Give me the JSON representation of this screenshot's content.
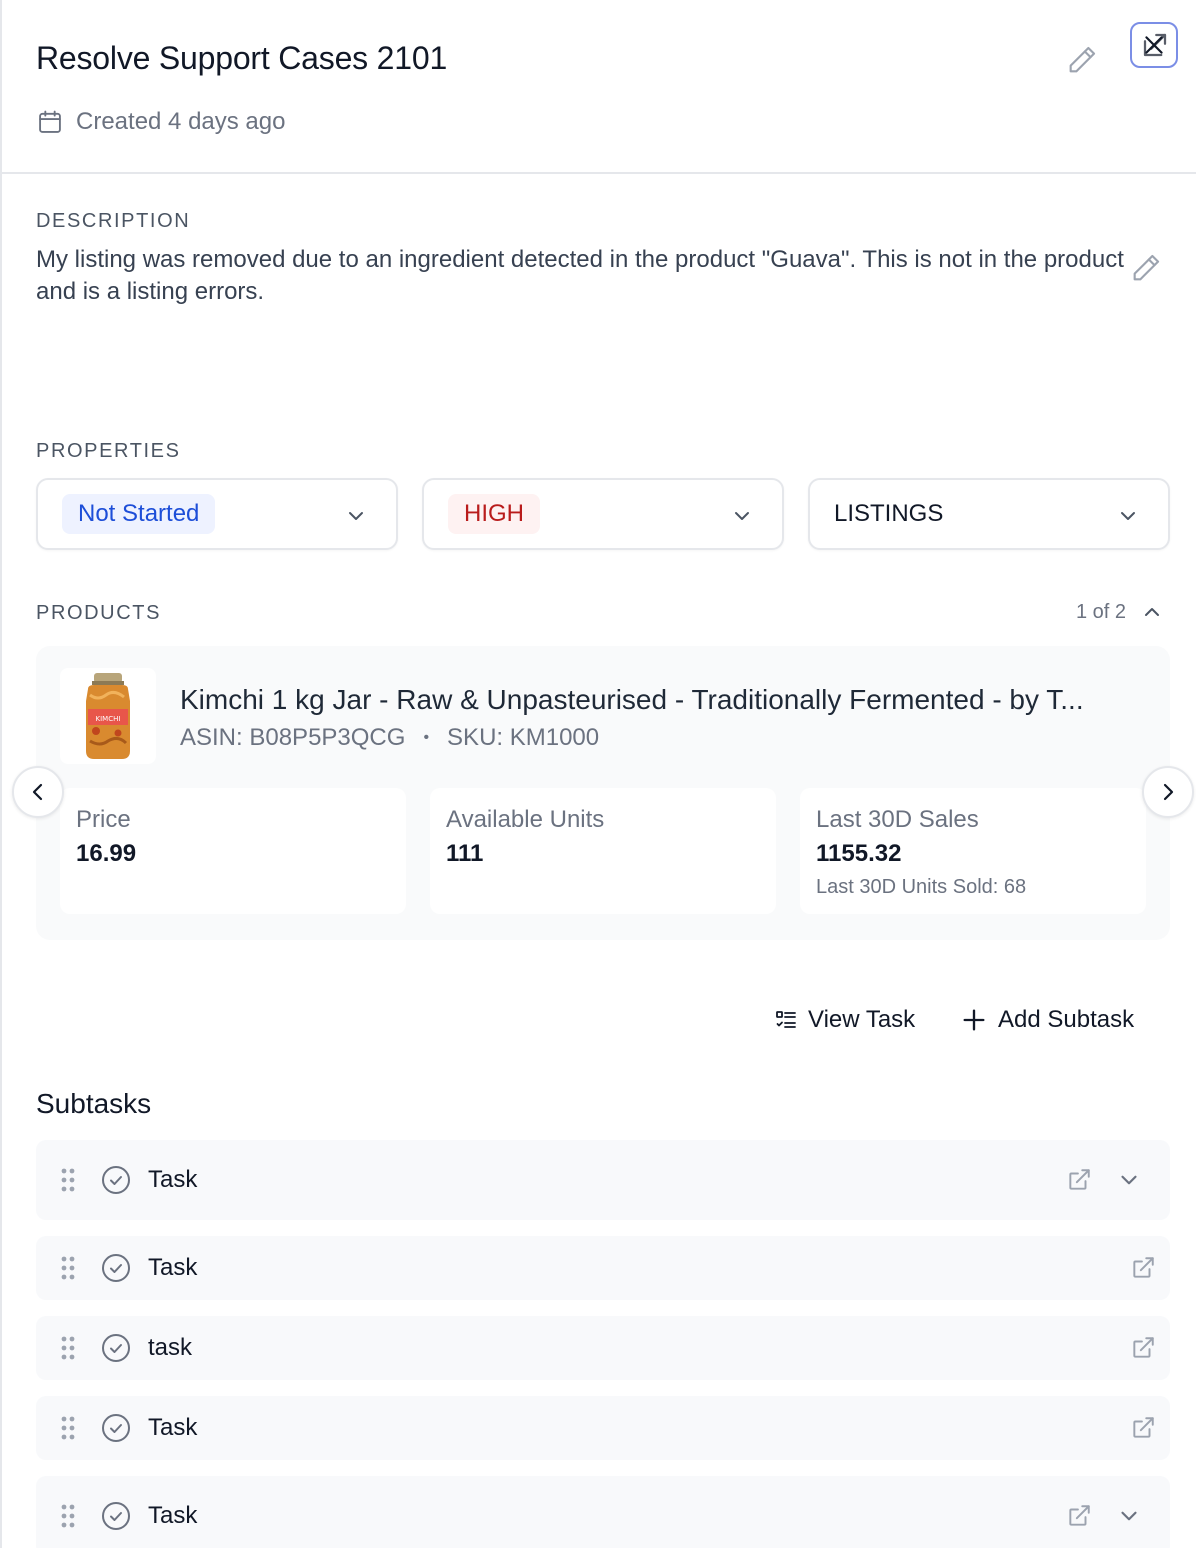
{
  "header": {
    "title": "Resolve Support Cases 2101",
    "created": "Created 4 days ago"
  },
  "description": {
    "label": "DESCRIPTION",
    "text": "My listing was removed due to an ingredient detected in the product \"Guava\". This is not in the product and is a listing errors."
  },
  "properties": {
    "label": "PROPERTIES",
    "status": "Not Started",
    "priority": "HIGH",
    "category": "LISTINGS"
  },
  "products": {
    "label": "PRODUCTS",
    "pager": "1 of 2",
    "item": {
      "title": "Kimchi 1 kg Jar - Raw & Unpasteurised - Traditionally Fermented - by T...",
      "asin": "ASIN: B08P5P3QCG",
      "separator": "•",
      "sku": "SKU: KM1000",
      "thumb_text": "KIMCHI"
    },
    "stats": [
      {
        "label": "Price",
        "value": "16.99",
        "sub": ""
      },
      {
        "label": "Available Units",
        "value": "111",
        "sub": ""
      },
      {
        "label": "Last 30D Sales",
        "value": "1155.32",
        "sub": "Last 30D Units Sold: 68"
      }
    ]
  },
  "actions": {
    "view_task": "View Task",
    "add_subtask": "Add Subtask"
  },
  "subtasks": {
    "title": "Subtasks",
    "items": [
      {
        "name": "Task"
      },
      {
        "name": "Task"
      },
      {
        "name": "task"
      },
      {
        "name": "Task"
      },
      {
        "name": "Task"
      }
    ]
  },
  "colors": {
    "accent_blue": "#1d4ed8",
    "priority_red": "#b91c1c",
    "focus_ring": "#7b8ee6"
  }
}
